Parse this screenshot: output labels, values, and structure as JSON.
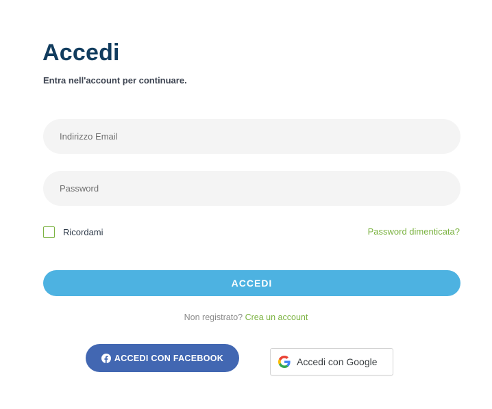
{
  "header": {
    "title": "Accedi",
    "subtitle": "Entra nell'account per continuare."
  },
  "form": {
    "email_placeholder": "Indirizzo Email",
    "email_value": "",
    "password_placeholder": "Password",
    "password_value": "",
    "remember_label": "Ricordami",
    "remember_checked": false,
    "forgot_link": "Password dimenticata?",
    "submit_label": "ACCEDI"
  },
  "register": {
    "prompt": "Non registrato?",
    "link": "Crea un account"
  },
  "social": {
    "facebook_label": "ACCEDI CON FACEBOOK",
    "facebook_icon": "facebook-icon",
    "google_label": "Accedi con Google",
    "google_icon": "google-icon"
  },
  "colors": {
    "title": "#113c5e",
    "accent_green": "#7cb342",
    "submit_blue": "#4db2e1",
    "facebook_blue": "#4267b2",
    "field_bg": "#f4f4f4"
  }
}
